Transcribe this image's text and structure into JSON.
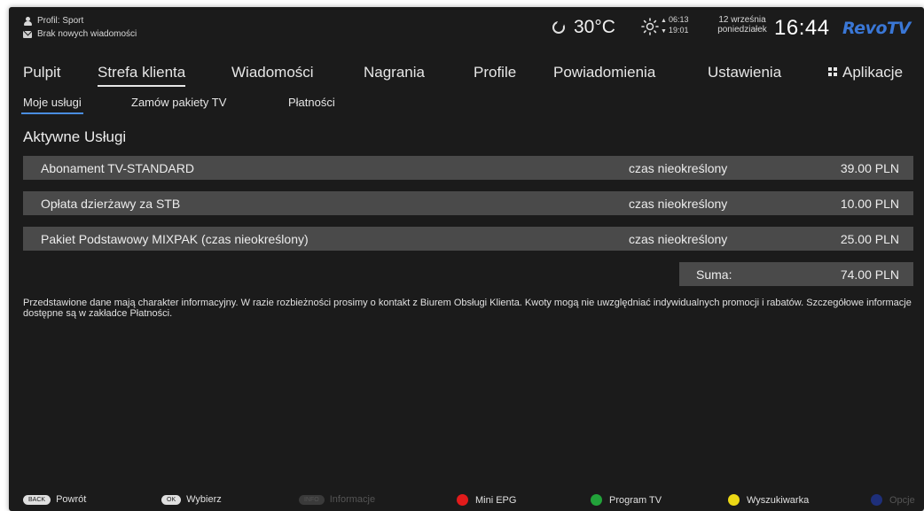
{
  "header": {
    "profile": "Profil: Sport",
    "messages": "Brak nowych wiadomości",
    "temperature": "30°C",
    "sunrise": "06:13",
    "sunset": "19:01",
    "date": "12 września",
    "weekday": "poniedziałek",
    "time": "16:44",
    "logo": "RevoTV"
  },
  "main_nav": {
    "items": [
      {
        "label": "Pulpit"
      },
      {
        "label": "Strefa klienta",
        "active": true
      },
      {
        "label": "Wiadomości"
      },
      {
        "label": "Nagrania"
      },
      {
        "label": "Profile"
      },
      {
        "label": "Powiadomienia"
      },
      {
        "label": "Ustawienia"
      },
      {
        "label": "Aplikacje",
        "icon": "apps-grid-icon"
      }
    ]
  },
  "sub_nav": {
    "items": [
      {
        "label": "Moje usługi",
        "active": true
      },
      {
        "label": "Zamów pakiety TV"
      },
      {
        "label": "Płatności"
      }
    ]
  },
  "services": {
    "title": "Aktywne Usługi",
    "rows": [
      {
        "name": "Abonament TV-STANDARD",
        "period": "czas nieokreślony",
        "price": "39.00 PLN"
      },
      {
        "name": "Opłata dzierżawy za STB",
        "period": "czas nieokreślony",
        "price": "10.00 PLN"
      },
      {
        "name": "Pakiet Podstawowy MIXPAK (czas nieokreślony)",
        "period": "czas nieokreślony",
        "price": "25.00 PLN"
      }
    ],
    "sum_label": "Suma:",
    "sum_value": "74.00 PLN"
  },
  "info_text": "Przedstawione dane mają charakter informacyjny. W razie rozbieżności prosimy o kontakt z Biurem Obsługi Klienta. Kwoty mogą nie uwzględniać indywidualnych promocji i rabatów. Szczegółowe informacje dostępne są w zakładce Płatności.",
  "hints": [
    {
      "key": "BACK",
      "label": "Powrót",
      "enabled": true
    },
    {
      "key": "OK",
      "label": "Wybierz",
      "enabled": true
    },
    {
      "key": "INFO",
      "label": "Informacje",
      "enabled": false
    },
    {
      "color": "#e21b1b",
      "label": "Mini EPG",
      "enabled": true
    },
    {
      "color": "#22a33a",
      "label": "Program TV",
      "enabled": true
    },
    {
      "color": "#ecd815",
      "label": "Wyszukiwarka",
      "enabled": true
    },
    {
      "color": "#1e2f7a",
      "label": "Opcje",
      "enabled": false
    }
  ],
  "colors": {
    "background": "#1b1b1b",
    "row": "#4a4a4a",
    "accent": "#4a8de0",
    "logo": "#3a77d6"
  }
}
